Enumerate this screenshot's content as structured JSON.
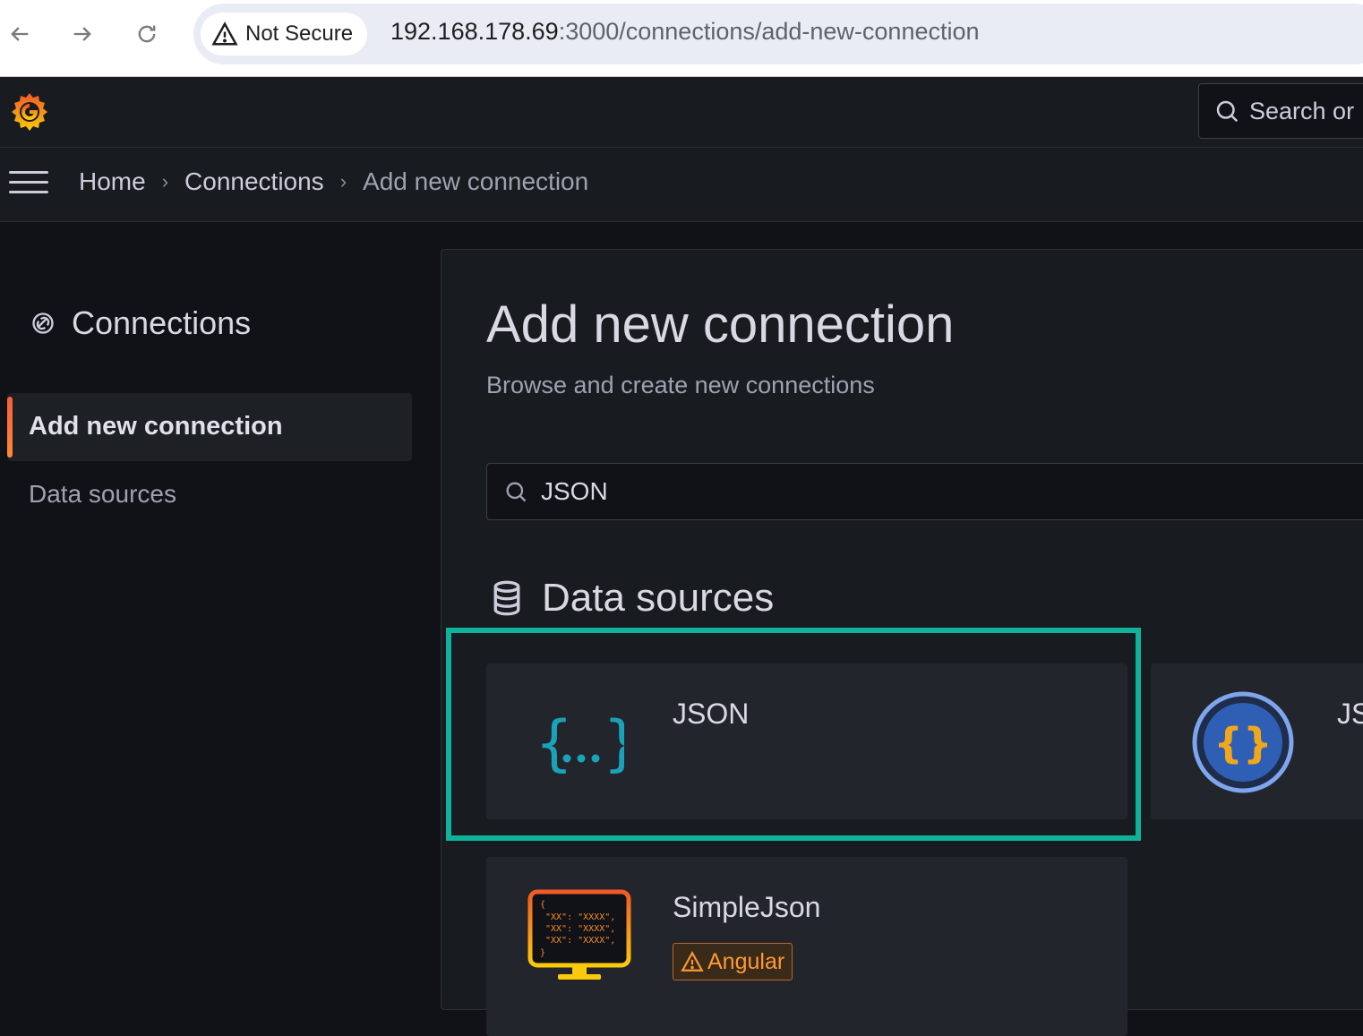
{
  "browser": {
    "security_label": "Not Secure",
    "url_host": "192.168.178.69",
    "url_rest": ":3000/connections/add-new-connection"
  },
  "topbar": {
    "search_text": "Search or"
  },
  "breadcrumb": {
    "items": [
      "Home",
      "Connections",
      "Add new connection"
    ]
  },
  "sidebar": {
    "title": "Connections",
    "items": [
      {
        "label": "Add new connection",
        "active": true
      },
      {
        "label": "Data sources",
        "active": false
      }
    ]
  },
  "main": {
    "title": "Add new connection",
    "subtitle": "Browse and create new connections",
    "search_value": "JSON",
    "section_title": "Data sources",
    "cards": [
      {
        "name": "JSON",
        "icon": "json-braces-icon"
      },
      {
        "name": "JS",
        "icon": "json-circle-icon"
      },
      {
        "name": "SimpleJson",
        "icon": "simplejson-monitor-icon",
        "badge": "Angular"
      }
    ],
    "simplejson_icon_text": [
      "{",
      "\"XX\": \"XXXX\",",
      "\"XX\": \"XXXX\",",
      "\"XX\": \"XXXX\",",
      "}"
    ]
  },
  "colors": {
    "highlight": "#10b29a",
    "accent": "#f55f3e",
    "badge_warning": "#ff9830"
  }
}
